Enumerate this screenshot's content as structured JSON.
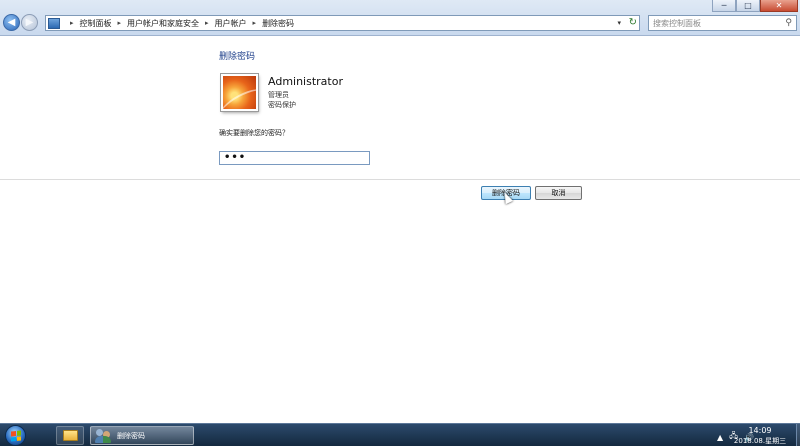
{
  "window": {
    "minimize": "─",
    "maximize": "□",
    "close": "✕"
  },
  "address_bar": {
    "crumbs": [
      "控制面板",
      "用户帐户和家庭安全",
      "用户帐户",
      "删除密码"
    ],
    "separator": "▸",
    "dropdown": "▾",
    "refresh": "↻"
  },
  "search": {
    "placeholder": "搜索控制面板",
    "icon": "⚲"
  },
  "content": {
    "title": "删除密码",
    "user_name": "Administrator",
    "user_role": "管理员",
    "user_status": "密码保护",
    "question": "确实要删除您的密码？",
    "password_value": "•••"
  },
  "buttons": {
    "delete": "删除密码",
    "cancel": "取消"
  },
  "taskbar": {
    "active_task": "删除密码",
    "tray": {
      "expand": "▲",
      "network": "🖧",
      "volume": "🔊"
    },
    "clock_time": "14:09",
    "clock_date": "2018.08.星期三"
  },
  "colors": {
    "accent": "#1e3f8a",
    "taskbar": "#1b3350"
  }
}
